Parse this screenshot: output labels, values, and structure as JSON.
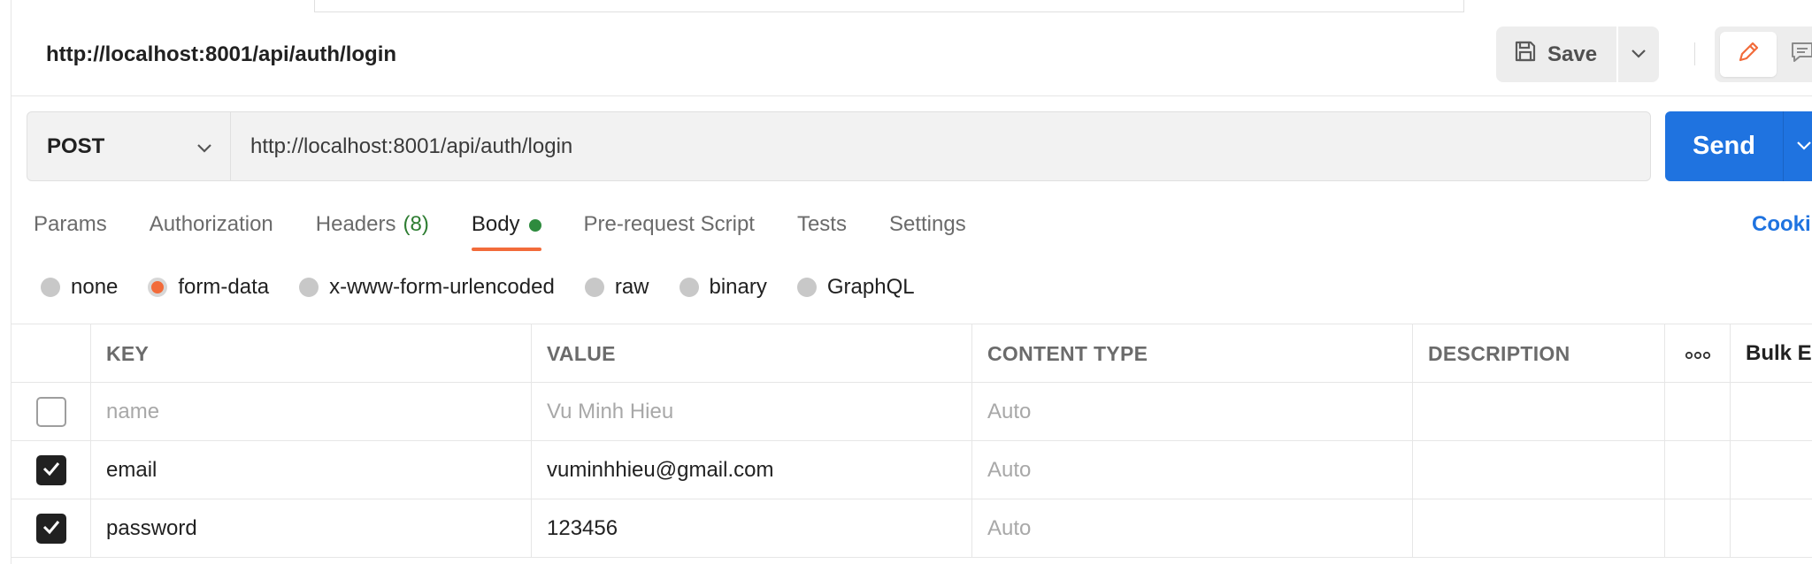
{
  "request": {
    "title": "http://localhost:8001/api/auth/login",
    "save_label": "Save",
    "method": "POST",
    "url": "http://localhost:8001/api/auth/login",
    "send_label": "Send"
  },
  "tabs": [
    {
      "label": "Params"
    },
    {
      "label": "Authorization"
    },
    {
      "label": "Headers",
      "count": "(8)"
    },
    {
      "label": "Body",
      "active": true
    },
    {
      "label": "Pre-request Script"
    },
    {
      "label": "Tests"
    },
    {
      "label": "Settings"
    }
  ],
  "cookies_label": "Cooki",
  "body_types": [
    {
      "label": "none",
      "checked": false
    },
    {
      "label": "form-data",
      "checked": true
    },
    {
      "label": "x-www-form-urlencoded",
      "checked": false
    },
    {
      "label": "raw",
      "checked": false
    },
    {
      "label": "binary",
      "checked": false
    },
    {
      "label": "GraphQL",
      "checked": false
    }
  ],
  "table": {
    "headers": {
      "key": "KEY",
      "value": "VALUE",
      "content_type": "CONTENT TYPE",
      "description": "DESCRIPTION",
      "bulk_edit": "Bulk E"
    },
    "rows": [
      {
        "checked": false,
        "key": "name",
        "value": "Vu Minh Hieu",
        "content_type": "Auto",
        "description": ""
      },
      {
        "checked": true,
        "key": "email",
        "value": "vuminhhieu@gmail.com",
        "content_type": "Auto",
        "description": ""
      },
      {
        "checked": true,
        "key": "password",
        "value": "123456",
        "content_type": "Auto",
        "description": ""
      }
    ]
  },
  "colors": {
    "accent_orange": "#f26b3a",
    "send_blue": "#1f73e0",
    "active_dot_green": "#2e8b3e"
  }
}
